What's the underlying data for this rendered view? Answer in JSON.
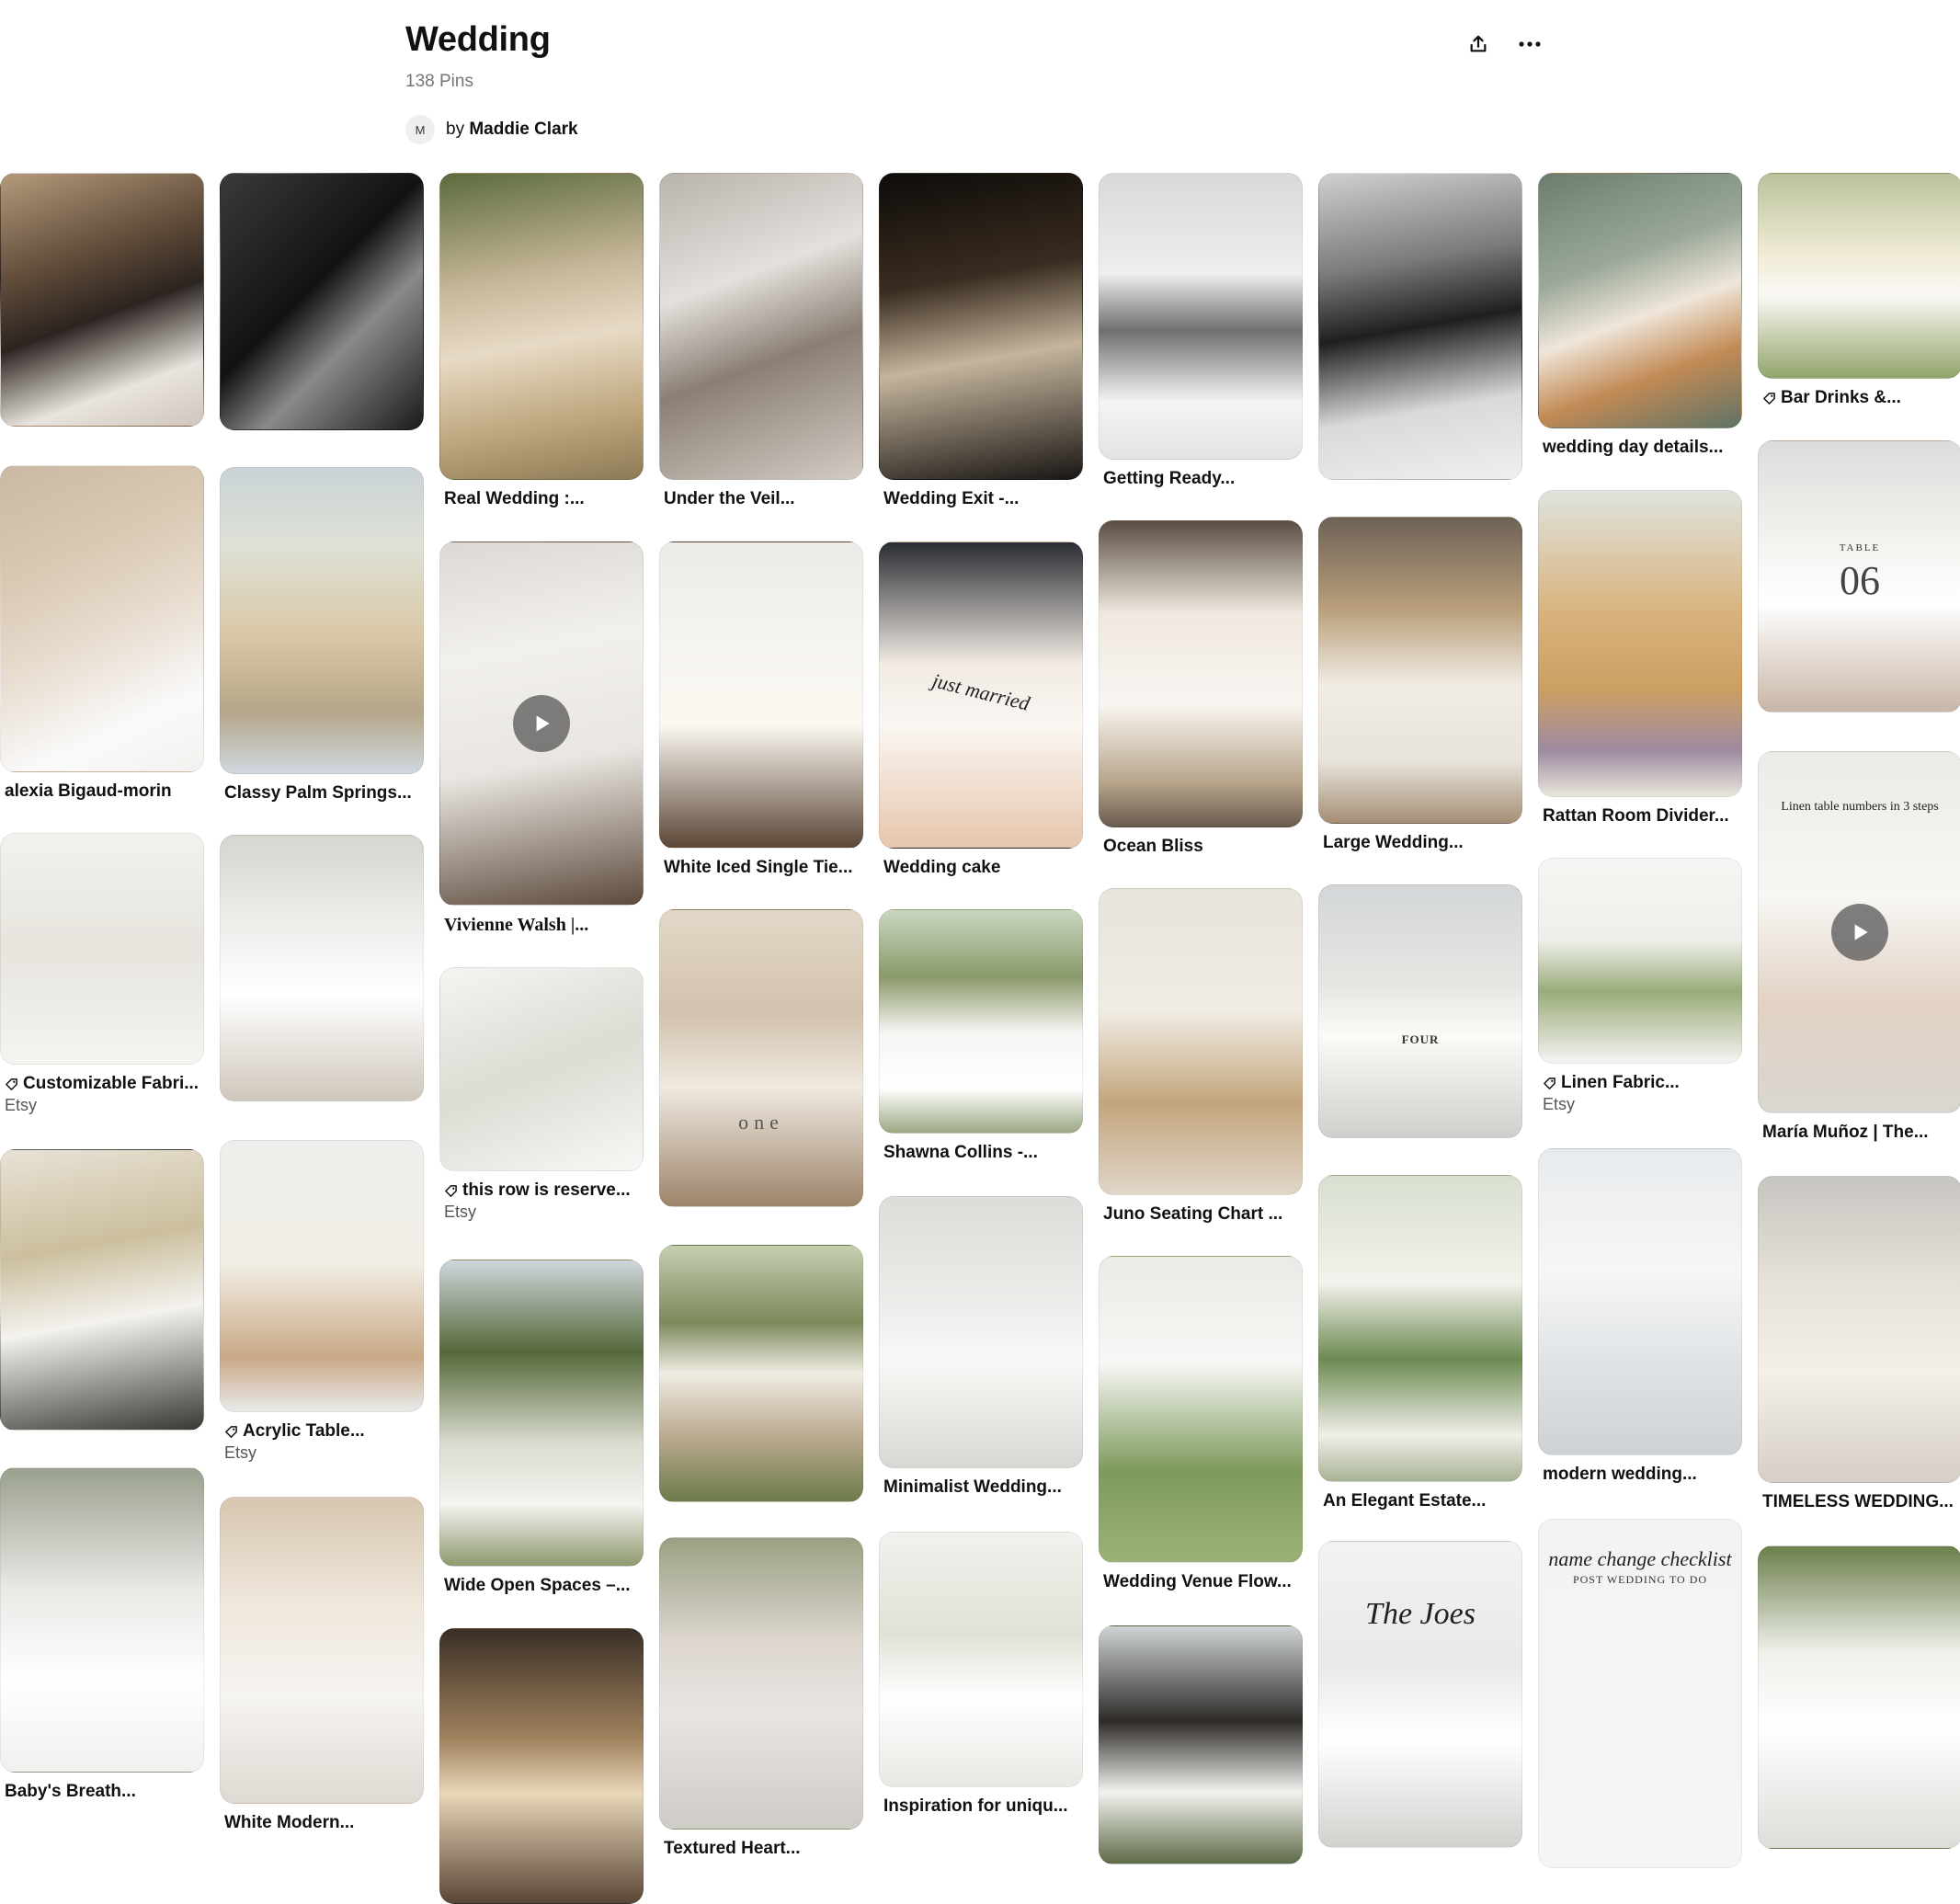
{
  "board": {
    "title": "Wedding",
    "pin_count": "138 Pins",
    "owner_prefix": "by",
    "owner_name": "Maddie Clark",
    "owner_initial": "M"
  },
  "header_actions": {
    "share_icon": "share-icon",
    "more_icon": "more-dots-icon"
  },
  "pins": [
    {
      "title": "",
      "bg": "linear-gradient(160deg,#b59a7c 0%,#5e4a38 35%,#2c2420 55%,#e9e4de 80%,#cfc6bc 100%)"
    },
    {
      "title": "alexia Bigaud-morin",
      "bg": "linear-gradient(155deg,#c9b9a4 0%,#d9c8b2 30%,#e8ddd0 55%,#fafafa 80%,#f3f1ee 100%)"
    },
    {
      "title": "Customizable Fabri...",
      "tag": true,
      "sub": "Etsy",
      "bg": "linear-gradient(180deg,#f2f1ec 0%,#e6e4dd 50%,#f5f4f0 100%)"
    },
    {
      "title": "",
      "bg": "linear-gradient(170deg,#e8e2d6 0%,#cbbf9e 35%,#f4f2ee 60%,#3a3834 100%)"
    },
    {
      "title": "Baby's Breath...",
      "bg": "linear-gradient(180deg,#9aa08e 0%,#e9e9e6 40%,#ffffff 70%,#f0f0ee 100%)"
    },
    {
      "title": "",
      "bg": "linear-gradient(135deg,#3a3a3a 0%,#121212 45%,#8a8a8a 65%,#1a1a1a 100%)"
    },
    {
      "title": "Classy Palm Springs...",
      "bg": "linear-gradient(180deg,#c9d2d6 0%,#dfe1d7 25%,#d9c8a6 55%,#b5a689 80%,#cfd7df 100%)"
    },
    {
      "title": "",
      "bg": "linear-gradient(180deg,#d6d6d0 0%,#f2f2f0 40%,#ffffff 60%,#cfc7bc 100%)"
    },
    {
      "title": "Acrylic Table...",
      "tag": true,
      "sub": "Etsy",
      "bg": "linear-gradient(180deg,#eeeeec 0%,#f2efe6 45%,#c9a986 80%,#e9e9e9 100%)"
    },
    {
      "title": "White Modern...",
      "bg": "linear-gradient(180deg,#d7c7b0 0%,#efe7dc 35%,#f6f4f1 65%,#dedad3 100%)"
    },
    {
      "title": "Real Wedding :...",
      "bg": "linear-gradient(170deg,#5c6b3d 0%,#c7b79a 35%,#e7dac5 55%,#bda57c 80%,#8c7a55 100%)"
    },
    {
      "title": "Vivienne Walsh |...",
      "serif": true,
      "video": true,
      "bg": "linear-gradient(170deg,#dcd9d4 0%,#f2f0ed 30%,#e9e6e1 60%,#5d4a3c 100%)"
    },
    {
      "title": "this row is reserve...",
      "tag": true,
      "sub": "Etsy",
      "bg": "linear-gradient(160deg,#f4f4f2 0%,#dcdcd4 50%,#f7f7f5 100%)"
    },
    {
      "title": "Wide Open Spaces –...",
      "bg": "linear-gradient(180deg,#cfd6dc 0%,#56683a 30%,#d9dccf 60%,#f3f3f0 80%,#8f9a6e 100%)"
    },
    {
      "title": "",
      "bg": "linear-gradient(180deg,#3a2f26 0%,#a0825e 40%,#e8d7b8 60%,#5a4636 100%)"
    },
    {
      "title": "Under the Veil...",
      "bg": "linear-gradient(160deg,#b9b3ad 0%,#e4e0db 35%,#8a7f76 60%,#d3ccc4 100%)"
    },
    {
      "title": "White Iced Single Tie...",
      "bg": "linear-gradient(180deg,#ecebe8 0%,#f6f4ef 35%,#fbf8f1 60%,#5b4636 100%)"
    },
    {
      "title": "",
      "bg": "linear-gradient(180deg,#e3d8c8 0%,#d2c2ad 35%,#efe9e0 60%,#9c846a 100%)"
    },
    {
      "title": "",
      "bg": "linear-gradient(180deg,#c4cfb1 0%,#7d8a5b 30%,#f0ece3 50%,#b9a88e 75%,#6c7b49 100%)"
    },
    {
      "title": "Textured Heart...",
      "bg": "linear-gradient(180deg,#9aa082 0%,#ddd6cf 35%,#e8e5e1 60%,#cfcbc6 100%)"
    },
    {
      "title": "Wedding Exit -...",
      "bg": "linear-gradient(170deg,#0e0c0a 0%,#3a2c20 35%,#c4b59c 60%,#1a1614 100%)"
    },
    {
      "title": "Wedding cake",
      "bg": "linear-gradient(180deg,#2a2d33 0%,#f2ebe4 40%,#faf6f2 60%,#e6c6ad 100%)"
    },
    {
      "title": "Shawna Collins -...",
      "bg": "linear-gradient(180deg,#c9d6c0 0%,#8b9a6b 30%,#f5f5f3 55%,#ffffff 80%,#9aa883 100%)"
    },
    {
      "title": "Minimalist Wedding...",
      "bg": "linear-gradient(180deg,#dcdcd9 0%,#ececea 40%,#f8f8f6 60%,#d7d7d4 100%)"
    },
    {
      "title": "Inspiration for uniqu...",
      "bg": "linear-gradient(180deg,#f2f1ee 0%,#dfe2d6 40%,#ffffff 65%,#e9e8e4 100%)"
    },
    {
      "title": "Getting Ready...",
      "bg": "linear-gradient(180deg,#d9d9d9 0%,#eeeeee 35%,#6f6f6f 55%,#f4f4f4 80%,#e3e3e3 100%)"
    },
    {
      "title": "Ocean Bliss",
      "bg": "linear-gradient(180deg,#5a4e44 0%,#efe8df 30%,#f8f5f1 60%,#b9a78d 85%,#6a5c4e 100%)"
    },
    {
      "title": "Juno Seating Chart ...",
      "bg": "linear-gradient(180deg,#e7e3dd 0%,#f1ece4 40%,#c3a57d 70%,#e0d6c8 100%)"
    },
    {
      "title": "Wedding Venue Flow...",
      "bg": "linear-gradient(180deg,#e9ebe6 0%,#f7f7f5 35%,#7e9a5c 70%,#9bb277 100%)"
    },
    {
      "title": "",
      "bg": "linear-gradient(180deg,#cfd3d4 0%,#2e2b28 40%,#f2f2ef 70%,#5d6a47 100%)"
    },
    {
      "title": "",
      "bg": "linear-gradient(170deg,#cfd0d0 0%,#7b7b7b 30%,#1f1f1f 50%,#d9d9d9 75%,#efefef 100%)"
    },
    {
      "title": "Large Wedding...",
      "bg": "linear-gradient(180deg,#6e6257 0%,#b99f7b 30%,#f1ece4 55%,#e7e2da 80%,#a58f75 100%)"
    },
    {
      "title": "",
      "bg": "linear-gradient(180deg,#d3d6d9 0%,#e7e6e2 40%,#fbfaf7 60%,#cfd0cb 100%)"
    },
    {
      "title": "An Elegant Estate...",
      "bg": "linear-gradient(180deg,#d8dfd0 0%,#f3f2ec 35%,#6d8a52 60%,#f0efe9 85%,#a8b394 100%)"
    },
    {
      "title": "",
      "bg": "linear-gradient(180deg,#f2f2f0 0%,#e9e9e7 40%,#ffffff 65%,#d1d1ce 100%)"
    },
    {
      "title": "wedding day details...",
      "bg": "linear-gradient(160deg,#6b7d70 0%,#9ba899 35%,#efe6da 55%,#c28a55 75%,#5f7366 100%)"
    },
    {
      "title": "Rattan Room Divider...",
      "bg": "linear-gradient(180deg,#dfe3dd 0%,#d8b27d 40%,#cc9f63 65%,#9d8aa0 85%,#e9e6dd 100%)"
    },
    {
      "title": "Linen Fabric...",
      "tag": true,
      "sub": "Etsy",
      "bg": "linear-gradient(180deg,#f5f5f3 0%,#eeefea 40%,#9aab7a 65%,#f4f4f1 100%)"
    },
    {
      "title": "modern wedding...",
      "bg": "linear-gradient(180deg,#e8ebee 0%,#f6f6f5 40%,#dfe3e6 70%,#cfd2d4 100%)"
    },
    {
      "title": "",
      "bg": "linear-gradient(180deg,#f4f3f1 0%,#f6f5f3 100%)"
    },
    {
      "title": "Bar Drinks &...",
      "tag": true,
      "bg": "linear-gradient(180deg,#b9c29b 0%,#f1ecd6 40%,#f9f8f4 60%,#93a56b 100%)"
    },
    {
      "title": "",
      "bg": "linear-gradient(180deg,#dcdddb 0%,#f5f4f1 40%,#ffffff 60%,#c9b6a7 100%)"
    },
    {
      "title": "María Muñoz | The...",
      "video": true,
      "bg": "linear-gradient(180deg,#ecebe8 0%,#f7f6f3 40%,#e2d2c4 70%,#d9d6d1 100%)"
    },
    {
      "title": "TIMELESS WEDDING...",
      "bg": "linear-gradient(180deg,#c7c5c0 0%,#e6e1da 35%,#f4efe7 65%,#d5cfc6 100%)"
    },
    {
      "title": "",
      "bg": "linear-gradient(180deg,#6d7f4c 0%,#eef0ea 35%,#ffffff 60%,#dcdcd8 100%)"
    }
  ],
  "overlays": {
    "table_number": "TABLE",
    "table_06": "06",
    "linen_caption": "Linen table numbers in 3 steps",
    "checklist_title": "name change checklist",
    "checklist_sub": "POST WEDDING TO DO",
    "cake_script": "just married",
    "one_card": "one",
    "table_four": "FOUR",
    "the_joes": "The Joes"
  }
}
